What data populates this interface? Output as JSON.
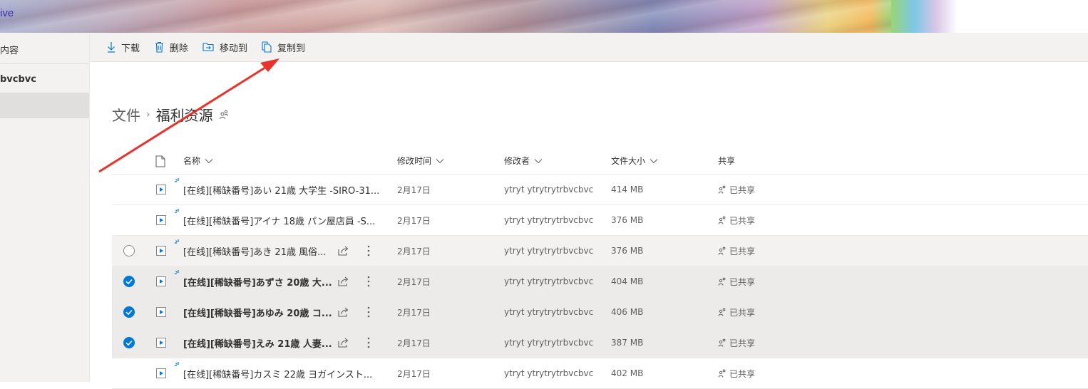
{
  "app": {
    "brand": "ive"
  },
  "nav": {
    "items": [
      {
        "label": "内容"
      },
      {
        "label": "bvcbvc"
      },
      {
        "label": ""
      }
    ]
  },
  "toolbar": {
    "download_label": "下载",
    "delete_label": "删除",
    "move_label": "移动到",
    "copy_label": "复制到"
  },
  "breadcrumb": {
    "root": "文件",
    "current": "福利资源"
  },
  "columns": {
    "name": "名称",
    "modified": "修改时间",
    "modified_by": "修改者",
    "size": "文件大小",
    "sharing": "共享"
  },
  "rows": [
    {
      "name": "[在线][稀缺番号]あい 21歳 大学生 -SIRO-31...",
      "modified": "2月17日",
      "modified_by": "ytryt ytrytrytrbvcbvc",
      "size": "414 MB",
      "sharing": "已共享"
    },
    {
      "name": "[在线][稀缺番号]アイナ 18歳 パン屋店員 -S...",
      "modified": "2月17日",
      "modified_by": "ytryt ytrytrytrbvcbvc",
      "size": "376 MB",
      "sharing": "已共享"
    },
    {
      "name": "[在线][稀缺番号]あき 21歳 風俗...",
      "modified": "2月17日",
      "modified_by": "ytryt ytrytrytrbvcbvc",
      "size": "376 MB",
      "sharing": "已共享"
    },
    {
      "name": "[在线][稀缺番号]あずさ 20歳 大...",
      "modified": "2月17日",
      "modified_by": "ytryt ytrytrytrbvcbvc",
      "size": "404 MB",
      "sharing": "已共享"
    },
    {
      "name": "[在线][稀缺番号]あゆみ 20歳 コ...",
      "modified": "2月17日",
      "modified_by": "ytryt ytrytrytrbvcbvc",
      "size": "406 MB",
      "sharing": "已共享"
    },
    {
      "name": "[在线][稀缺番号]えみ 21歳 人妻...",
      "modified": "2月17日",
      "modified_by": "ytryt ytrytrytrbvcbvc",
      "size": "387 MB",
      "sharing": "已共享"
    },
    {
      "name": "[在线][稀缺番号]カスミ 22歳 ヨガインスト...",
      "modified": "2月17日",
      "modified_by": "ytryt ytrytrytrbvcbvc",
      "size": "402 MB",
      "sharing": "已共享"
    }
  ],
  "colors": {
    "accent": "#0078d4",
    "annotation": "#e8322b"
  }
}
